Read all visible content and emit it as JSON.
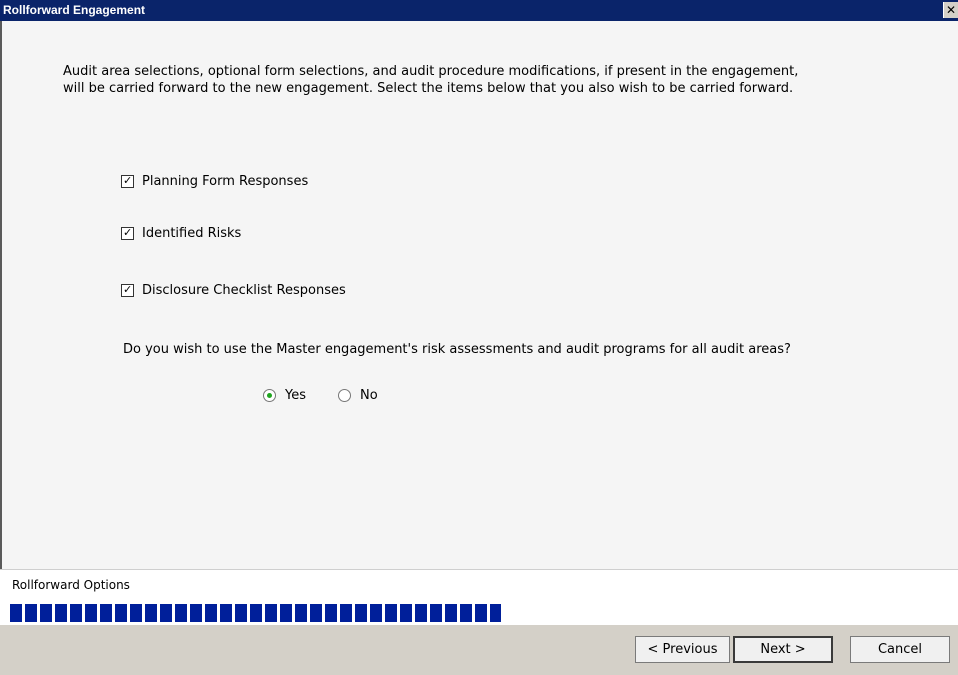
{
  "window": {
    "title": "Rollforward Engagement",
    "close_glyph": "✕"
  },
  "main": {
    "intro_line1": "Audit area selections, optional form selections, and audit procedure modifications, if present in the engagement,",
    "intro_line2": "will be carried forward to the new engagement. Select the items below that you also wish to be carried forward.",
    "checkboxes": [
      {
        "label": "Planning Form Responses",
        "checked": true
      },
      {
        "label": "Identified Risks",
        "checked": true
      },
      {
        "label": "Disclosure Checklist Responses",
        "checked": true
      }
    ],
    "question": "Do you wish to use the Master engagement's risk assessments and audit programs for all audit areas?",
    "radio_options": [
      {
        "label": "Yes",
        "selected": true
      },
      {
        "label": "No",
        "selected": false
      }
    ]
  },
  "status": {
    "label": "Rollforward Options",
    "progress": 0.51,
    "progress_color": "#001f9a"
  },
  "buttons": {
    "previous": "< Previous",
    "next": "Next >",
    "cancel": "Cancel"
  },
  "colors": {
    "titlebar": "#0a246a",
    "radio_selected": "#1fa51f"
  }
}
